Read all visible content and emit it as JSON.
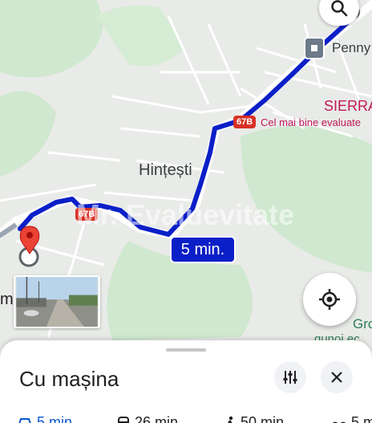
{
  "map": {
    "place_hintesti": "Hințești",
    "place_penny": "Penny",
    "place_sierra": "SIERRA",
    "sierra_subtitle": "Cel mai bine evaluate",
    "place_gro": "Gro",
    "place_gro_sub": "gunoi ec",
    "road_67b_top": "67B",
    "road_67b_left": "67B",
    "place_left_edge": "m",
    "watermark": "Mr. Evaluevitate",
    "route_duration": "5 min.",
    "colors": {
      "route": "#0b1fc8",
      "pin": "#ea4335",
      "road_shield": "#d93025",
      "park": "#cfe8cf"
    }
  },
  "controls": {
    "search_icon": "search-icon",
    "locate_icon": "my-location-icon"
  },
  "sheet": {
    "title": "Cu mașina",
    "filter_icon": "tune-icon",
    "close_icon": "close-icon",
    "modes": [
      {
        "icon": "car-icon",
        "label": "5 min"
      },
      {
        "icon": "transit-icon",
        "label": "26 min"
      },
      {
        "icon": "walk-icon",
        "label": "50 min"
      },
      {
        "icon": "bike-icon",
        "label": "5 m"
      }
    ]
  }
}
